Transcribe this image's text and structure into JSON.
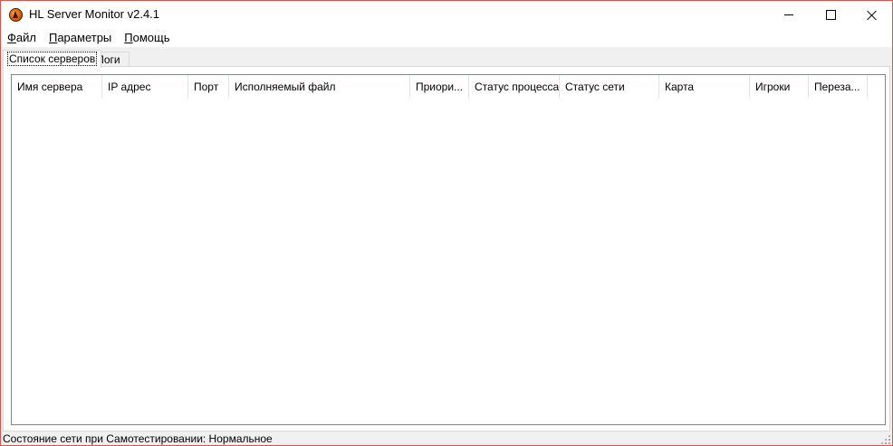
{
  "window": {
    "title": "HL Server Monitor v2.4.1",
    "icon": "hl-server-monitor-icon",
    "border_color": "#d9534f"
  },
  "menu": {
    "items": [
      {
        "label": "Файл",
        "accel": "Ф",
        "rest": "айл"
      },
      {
        "label": "Параметры",
        "accel": "П",
        "rest": "араметры"
      },
      {
        "label": "Помощь",
        "accel": "П",
        "rest": "омощь"
      }
    ]
  },
  "tabs": [
    {
      "label": "Список серверов",
      "active": true
    },
    {
      "label": "Логи",
      "active": false
    }
  ],
  "server_list": {
    "columns": [
      {
        "label": "Имя сервера"
      },
      {
        "label": "IP адрес"
      },
      {
        "label": "Порт"
      },
      {
        "label": "Исполняемый файл"
      },
      {
        "label": "Приори..."
      },
      {
        "label": "Статус процесса"
      },
      {
        "label": "Статус сети"
      },
      {
        "label": "Карта"
      },
      {
        "label": "Игроки"
      },
      {
        "label": "Переза..."
      }
    ],
    "rows": []
  },
  "statusbar": {
    "text": "Состояние сети при Самотестировании: Нормальное"
  }
}
